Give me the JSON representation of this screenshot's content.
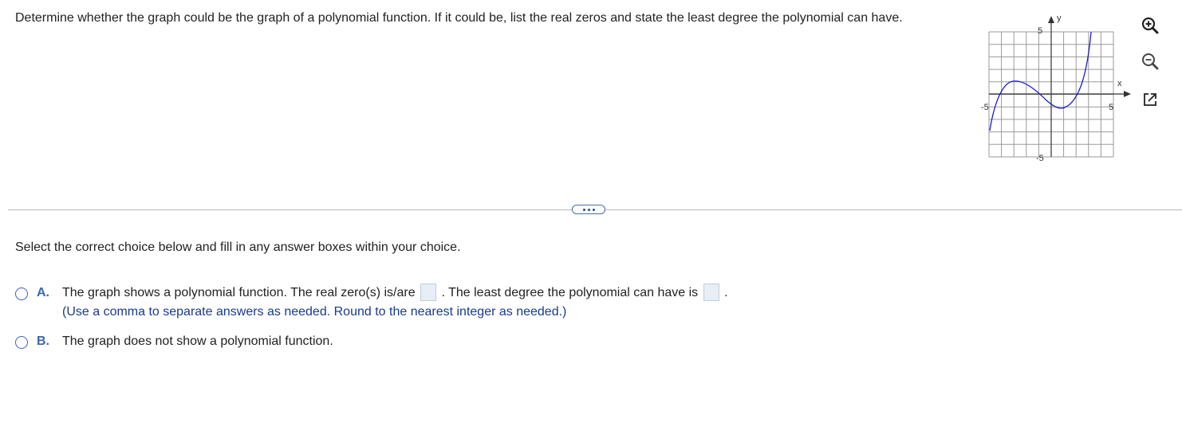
{
  "question": {
    "text": "Determine whether the graph could be the graph of a polynomial function. If it could be, list the real zeros and state the least degree the polynomial can have."
  },
  "graph": {
    "axis_labels": {
      "x": "x",
      "y": "y"
    },
    "tick_labels": {
      "x_min": "-5",
      "x_max": "5",
      "y_max": "5",
      "y_min": "-5"
    },
    "curve_color": "#1a1ad6",
    "grid_color": "#9a9a9a"
  },
  "tools": {
    "zoom_in": "zoom-in-icon",
    "zoom_out": "zoom-out-icon",
    "popout": "popout-icon"
  },
  "divider": {
    "more_label": "..."
  },
  "instruction": "Select the correct choice below and fill in any answer boxes within your choice.",
  "choices": [
    {
      "letter": "A.",
      "text_before": "The graph shows a polynomial function. The real zero(s) is/are",
      "text_middle": ". The least degree the polynomial can have is",
      "text_after": ".",
      "hint": "(Use a comma to separate answers as needed.  Round to the nearest integer as needed.)"
    },
    {
      "letter": "B.",
      "text": "The graph does not show a polynomial function."
    }
  ],
  "colors": {
    "accent": "#3a66b3",
    "hint": "#1a3a8e"
  }
}
